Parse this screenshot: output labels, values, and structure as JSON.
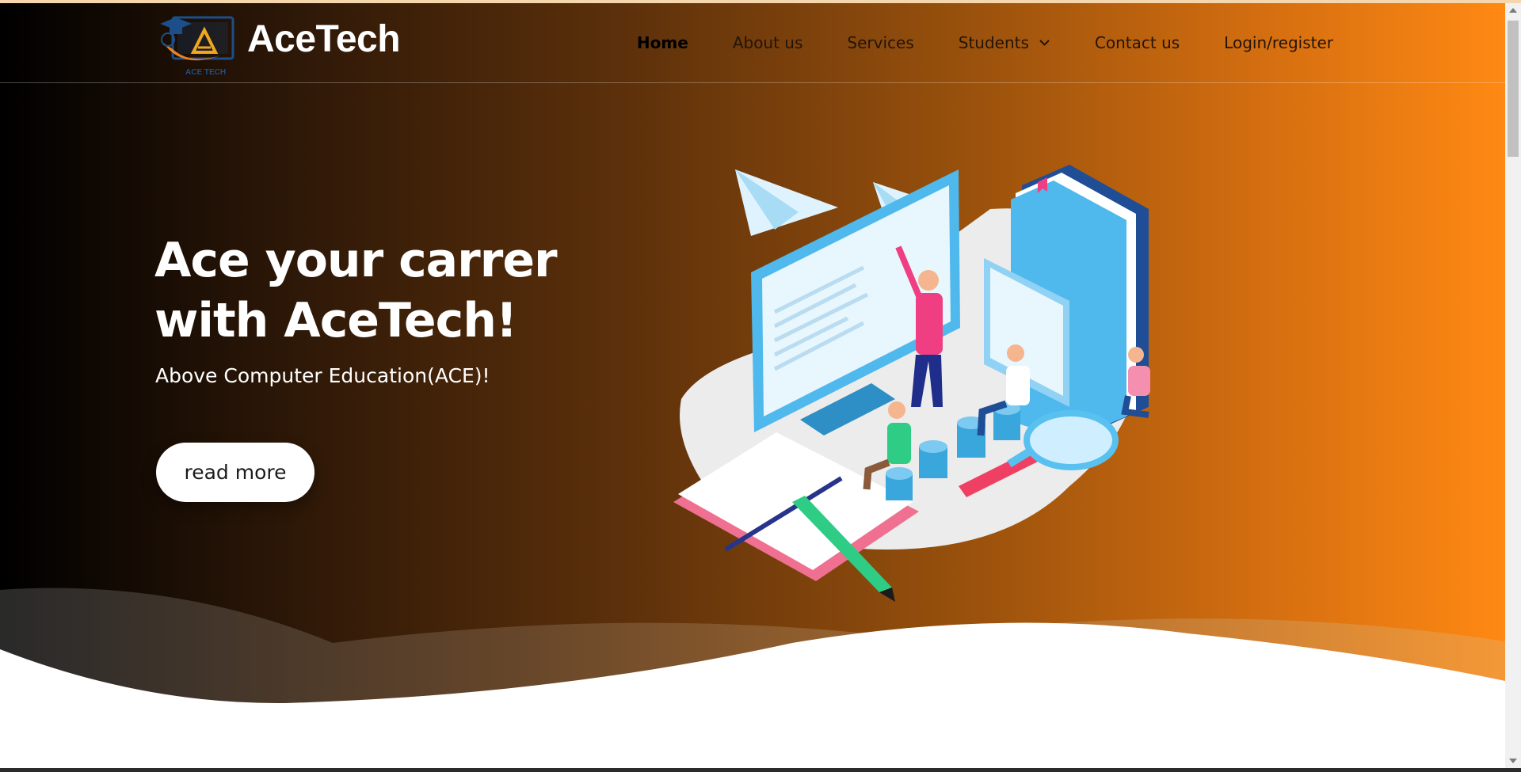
{
  "brand": {
    "name": "AceTech",
    "logo_caption": "ACE TECH"
  },
  "nav": {
    "items": [
      {
        "label": "Home",
        "active": true
      },
      {
        "label": "About us"
      },
      {
        "label": "Services"
      },
      {
        "label": "Students",
        "has_dropdown": true,
        "icon": "chevron-down-icon"
      },
      {
        "label": "Contact us"
      },
      {
        "label": "Login/register"
      }
    ]
  },
  "hero": {
    "title": "Ace your carrer with AceTech!",
    "subtitle": "Above Computer Education(ACE)!",
    "cta_label": "read more",
    "illustration": "students-learning-illustration"
  },
  "colors": {
    "gradient_start": "#000000",
    "gradient_mid": "#6b3a0c",
    "gradient_end": "#ff8913",
    "nav_text": "#231407",
    "button_bg": "#ffffff",
    "accent_blue": "#4fb8ec",
    "accent_pink": "#ef3f82"
  }
}
